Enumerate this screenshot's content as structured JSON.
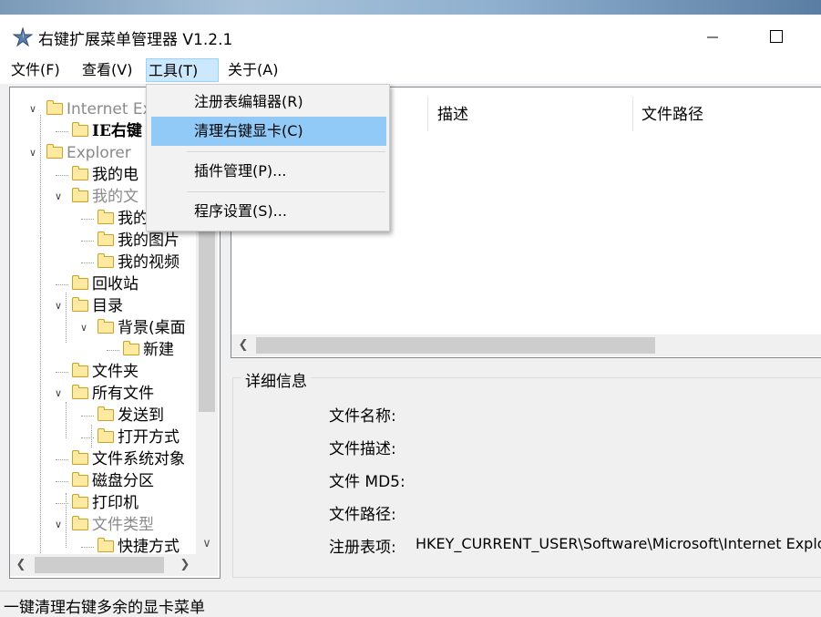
{
  "window": {
    "title": "右键扩展菜单管理器 V1.2.1",
    "minimize": "—",
    "maximize": "☐"
  },
  "menubar": [
    "文件(F)",
    "查看(V)",
    "工具(T)",
    "关于(A)"
  ],
  "tools_menu": {
    "items": [
      "注册表编辑器(R)",
      "清理右键显卡(C)",
      "插件管理(P)...",
      "程序设置(S)..."
    ],
    "highlighted": "清理右键显卡(C)"
  },
  "tree": [
    {
      "label": "Internet Ex",
      "grayed": true,
      "expanded": true
    },
    {
      "label": "IE右键",
      "bold": true
    },
    {
      "label": "Explorer",
      "grayed": true,
      "expanded": true
    },
    {
      "label": "我的电"
    },
    {
      "label": "我的文",
      "grayed": true,
      "expanded": true
    },
    {
      "label": "我的"
    },
    {
      "label": "我的图片"
    },
    {
      "label": "我的视频"
    },
    {
      "label": "回收站"
    },
    {
      "label": "目录",
      "expanded": true
    },
    {
      "label": "背景(桌面",
      "expanded": true
    },
    {
      "label": "新建"
    },
    {
      "label": "文件夹"
    },
    {
      "label": "所有文件",
      "expanded": true
    },
    {
      "label": "发送到"
    },
    {
      "label": "打开方式"
    },
    {
      "label": "文件系统对象"
    },
    {
      "label": "磁盘分区"
    },
    {
      "label": "打印机"
    },
    {
      "label": "文件类型",
      "grayed": true,
      "expanded": true
    },
    {
      "label": "快捷方式"
    }
  ],
  "list": {
    "columns": [
      "描述",
      "文件路径"
    ]
  },
  "details": {
    "title": "详细信息",
    "labels": [
      "文件名称:",
      "文件描述:",
      "文件 MD5:",
      "文件路径:",
      "注册表项:"
    ],
    "registry_value": "HKEY_CURRENT_USER\\Software\\Microsoft\\Internet Explorer\\"
  },
  "status": "一键清理右键多余的显卡菜单",
  "colors": {
    "menu_highlight": "#91c9f7",
    "menubar_active": "#cce8ff",
    "folder": "#fde9a0"
  }
}
